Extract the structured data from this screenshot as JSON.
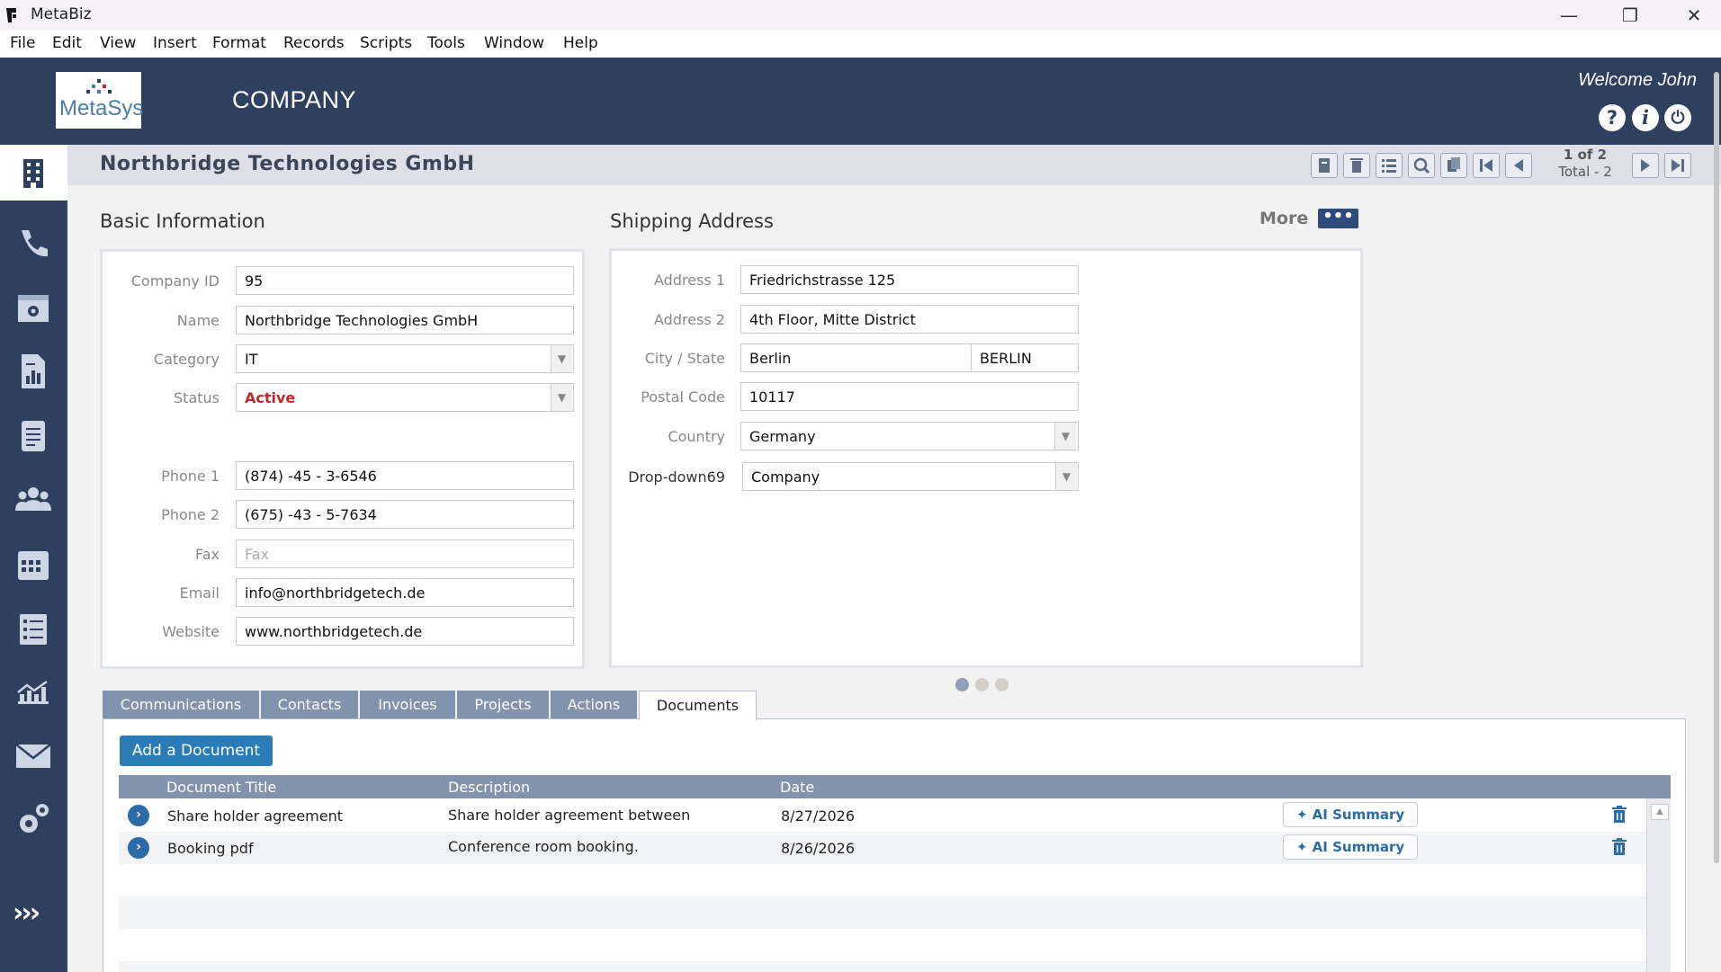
{
  "window": {
    "title": "MetaBiz",
    "controls": {
      "minimize": "—",
      "restore": "❐",
      "close": "✕"
    }
  },
  "menu": [
    "File",
    "Edit",
    "View",
    "Insert",
    "Format",
    "Records",
    "Scripts",
    "Tools",
    "Window",
    "Help"
  ],
  "header": {
    "logo_text": "MetaSys",
    "module_title": "COMPANY",
    "welcome": "Welcome John",
    "help_label": "?",
    "info_label": "i",
    "power_label": "⏻"
  },
  "record": {
    "title": "Northbridge Technologies GmbH",
    "count": "1 of 2",
    "total": "Total - 2"
  },
  "basic_info": {
    "title": "Basic Information",
    "fields": {
      "company_id": {
        "label": "Company ID",
        "value": "95"
      },
      "name": {
        "label": "Name",
        "value": "Northbridge Technologies GmbH"
      },
      "category": {
        "label": "Category",
        "value": "IT"
      },
      "status": {
        "label": "Status",
        "value": "Active",
        "color": "#c0282b"
      },
      "phone1": {
        "label": "Phone 1",
        "value": "(874) -45 - 3-6546"
      },
      "phone2": {
        "label": "Phone 2",
        "value": "(675) -43 - 5-7634"
      },
      "fax": {
        "label": "Fax",
        "placeholder": "Fax"
      },
      "email": {
        "label": "Email",
        "value": "info@northbridgetech.de"
      },
      "website": {
        "label": "Website",
        "value": "www.northbridgetech.de"
      }
    }
  },
  "shipping": {
    "title": "Shipping Address",
    "more_label": "More",
    "more_button": "•••",
    "fields": {
      "address1": {
        "label": "Address 1",
        "value": "Friedrichstrasse 125"
      },
      "address2": {
        "label": "Address 2",
        "value": "4th Floor, Mitte District"
      },
      "city_state": {
        "label": "City / State",
        "city": "Berlin",
        "state": "BERLIN"
      },
      "postal": {
        "label": "Postal Code",
        "value": "10117"
      },
      "country": {
        "label": "Country",
        "value": "Germany"
      },
      "dropdown69": {
        "label": "Drop-down69",
        "value": "Company"
      }
    }
  },
  "pager_dots": {
    "count": 3,
    "active_index": 0,
    "active_color": "#8fa0b8",
    "inactive_color": "#d4cfc6"
  },
  "tabs": [
    "Communications",
    "Contacts",
    "Invoices",
    "Projects",
    "Actions",
    "Documents"
  ],
  "active_tab": "Documents",
  "documents": {
    "add_button": "Add a Document",
    "columns": [
      "Document Title",
      "Description",
      "Date"
    ],
    "rows": [
      {
        "title": "Share holder agreement",
        "description": "Share holder agreement between",
        "date": "8/27/2026",
        "ai_label": "AI Summary"
      },
      {
        "title": "Booking pdf",
        "description": "Conference room booking.",
        "date": "8/26/2026",
        "ai_label": "AI Summary"
      }
    ]
  },
  "colors": {
    "header_bg": "#2f3f5e",
    "tab_bg": "#8293ad",
    "accent_blue": "#2b7bb6",
    "status_red": "#c0282b"
  },
  "sidebar_icons": [
    "company-icon",
    "phone-icon",
    "calendar-settings-icon",
    "report-icon",
    "document-icon",
    "contacts-icon",
    "calendar-icon",
    "checklist-icon",
    "chart-icon",
    "mail-icon",
    "settings-icon",
    "expand-icon"
  ],
  "sidebar_expand_label": "›››"
}
